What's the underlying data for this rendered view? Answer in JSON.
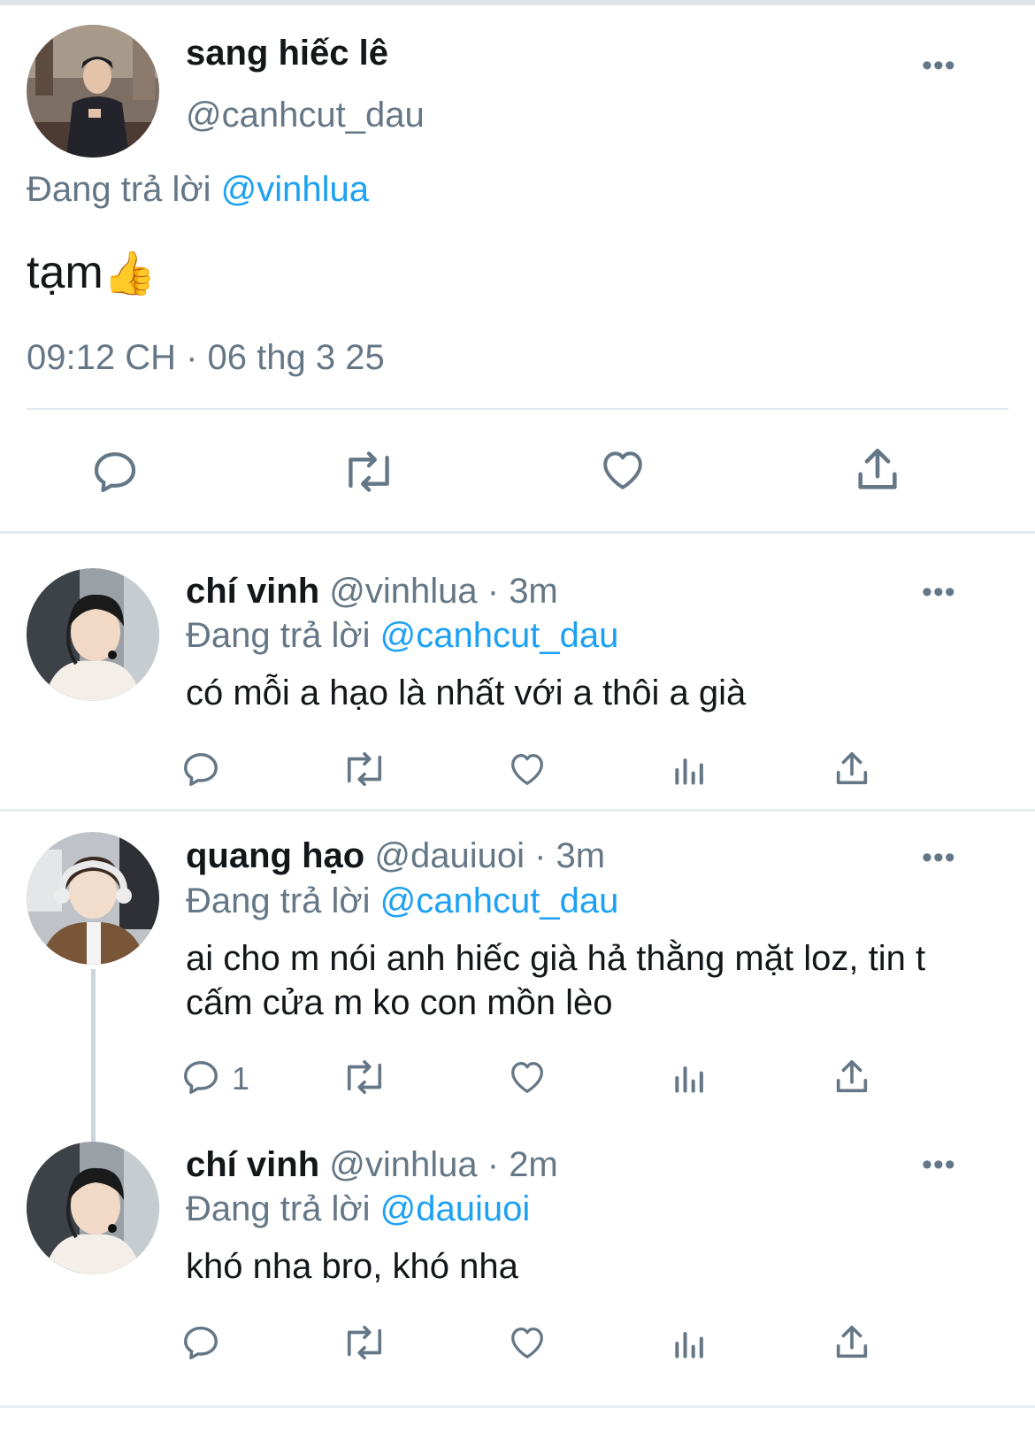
{
  "main_tweet": {
    "name": "sang hiếc lê",
    "handle": "@canhcut_dau",
    "replying_prefix": "Đang trả lời",
    "replying_to": "@vinhlua",
    "text": "tạm",
    "emoji": "👍",
    "timestamp": "09:12 CH · 06 thg 3 25"
  },
  "icons": {
    "reply": "reply-icon",
    "retweet": "retweet-icon",
    "like": "heart-icon",
    "views": "views-icon",
    "share": "share-icon",
    "more": "more-icon"
  },
  "more_label": "•••",
  "accent_color": "#1da1f2",
  "replies": [
    {
      "name": "chí vinh",
      "handle": "@vinhlua",
      "dot": " · ",
      "time": "3m",
      "replying_prefix": "Đang trả lời",
      "replying_to": "@canhcut_dau",
      "text": "có mỗi a hạo là nhất với a thôi a già",
      "reply_count": ""
    },
    {
      "name": "quang hạo",
      "handle": "@dauiuoi",
      "dot": " · ",
      "time": "3m",
      "replying_prefix": "Đang trả lời",
      "replying_to": "@canhcut_dau",
      "text": "ai cho m nói anh hiếc già hả thằng mặt loz, tin t cấm cửa m ko con mồn lèo",
      "reply_count": "1"
    },
    {
      "name": "chí vinh",
      "handle": "@vinhlua",
      "dot": " · ",
      "time": "2m",
      "replying_prefix": "Đang trả lời",
      "replying_to": "@dauiuoi",
      "text": "khó nha bro, khó nha",
      "reply_count": ""
    }
  ]
}
